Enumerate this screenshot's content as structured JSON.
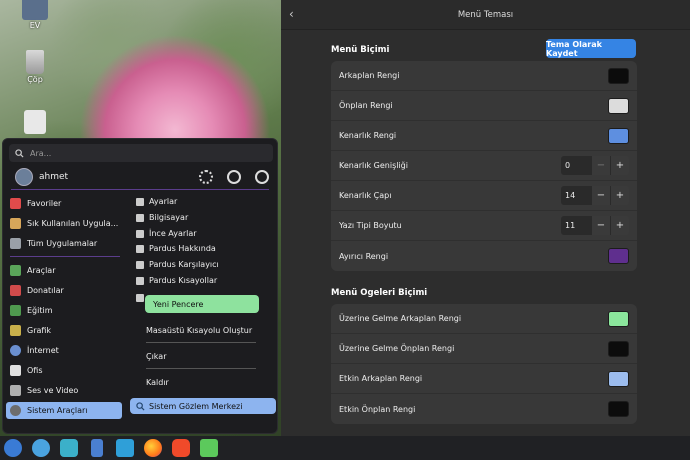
{
  "desktop": {
    "icons": [
      {
        "label": "EV",
        "color": "#5a6f8c"
      },
      {
        "label": "Çöp",
        "color": "#bcbcbc"
      }
    ]
  },
  "start_menu": {
    "search_placeholder": "Ara...",
    "username": "ahmet",
    "categories": [
      {
        "label": "Favoriler",
        "icon": "heart-icon",
        "color": "#e04b4b"
      },
      {
        "label": "Sık Kullanılan Uygula...",
        "icon": "folder-icon",
        "color": "#d7a65a"
      },
      {
        "label": "Tüm Uygulamalar",
        "icon": "grid-icon",
        "color": "#9aa0a8"
      },
      {
        "label": "Araçlar",
        "icon": "tools-icon",
        "color": "#5aa55a"
      },
      {
        "label": "Donatılar",
        "icon": "accessories-icon",
        "color": "#d14b4b"
      },
      {
        "label": "Eğitim",
        "icon": "education-icon",
        "color": "#4f9a4f"
      },
      {
        "label": "Grafik",
        "icon": "graphics-icon",
        "color": "#c9b04b"
      },
      {
        "label": "İnternet",
        "icon": "globe-icon",
        "color": "#6a8fd0"
      },
      {
        "label": "Ofis",
        "icon": "office-icon",
        "color": "#e0e0e0"
      },
      {
        "label": "Ses ve Video",
        "icon": "media-icon",
        "color": "#b0b0b0"
      },
      {
        "label": "Sistem Araçları",
        "icon": "system-icon",
        "color": "#6d6d6d"
      }
    ],
    "apps": [
      {
        "label": "Ayarlar"
      },
      {
        "label": "Bilgisayar"
      },
      {
        "label": "İnce Ayarlar"
      },
      {
        "label": "Pardus Hakkında"
      },
      {
        "label": "Pardus Karşılayıcı"
      },
      {
        "label": "Pardus Kısayollar"
      }
    ],
    "context_menu": {
      "items": [
        "Yeni Pencere",
        "Masaüstü Kısayolu Oluştur",
        "Çıkar",
        "Kaldır"
      ]
    },
    "selected_app": "Sistem Gözlem Merkezi"
  },
  "taskbar": {
    "items": [
      {
        "name": "pardus-menu-icon",
        "color": "#3a7bd5"
      },
      {
        "name": "browser-icon",
        "color": "#4aa3e0"
      },
      {
        "name": "system-monitor-icon",
        "color": "#3bb0c9"
      },
      {
        "name": "text-editor-icon",
        "color": "#4a7fd0"
      },
      {
        "name": "store-icon",
        "color": "#2f9fd8"
      },
      {
        "name": "firefox-icon",
        "color": "#ff7a1a"
      },
      {
        "name": "brave-icon",
        "color": "#f04a2a"
      },
      {
        "name": "extensions-icon",
        "color": "#5cc95c"
      }
    ]
  },
  "dialog": {
    "title": "Menü Teması",
    "section1_title": "Menü Biçimi",
    "save_button": "Tema Olarak Kaydet",
    "section1_rows": [
      {
        "label": "Arkaplan Rengi",
        "kind": "color",
        "value": "#0c0c0c"
      },
      {
        "label": "Önplan Rengi",
        "kind": "color",
        "value": "#dcdcdc"
      },
      {
        "label": "Kenarlık Rengi",
        "kind": "color",
        "value": "#5e8fe0"
      },
      {
        "label": "Kenarlık Genişliği",
        "kind": "spin",
        "value": "0"
      },
      {
        "label": "Kenarlık Çapı",
        "kind": "spin",
        "value": "14"
      },
      {
        "label": "Yazı Tipi Boyutu",
        "kind": "spin",
        "value": "11"
      },
      {
        "label": "Ayırıcı Rengi",
        "kind": "color",
        "value": "#5f2f8e"
      }
    ],
    "section2_title": "Menü Ogeleri Biçimi",
    "section2_rows": [
      {
        "label": "Üzerine Gelme Arkaplan Rengi",
        "kind": "color",
        "value": "#8be69c"
      },
      {
        "label": "Üzerine Gelme Önplan Rengi",
        "kind": "color",
        "value": "#0c0c0c"
      },
      {
        "label": "Etkin Arkaplan Rengi",
        "kind": "color",
        "value": "#9cbcee"
      },
      {
        "label": "Etkin Önplan Rengi",
        "kind": "color",
        "value": "#0c0c0c"
      }
    ]
  }
}
